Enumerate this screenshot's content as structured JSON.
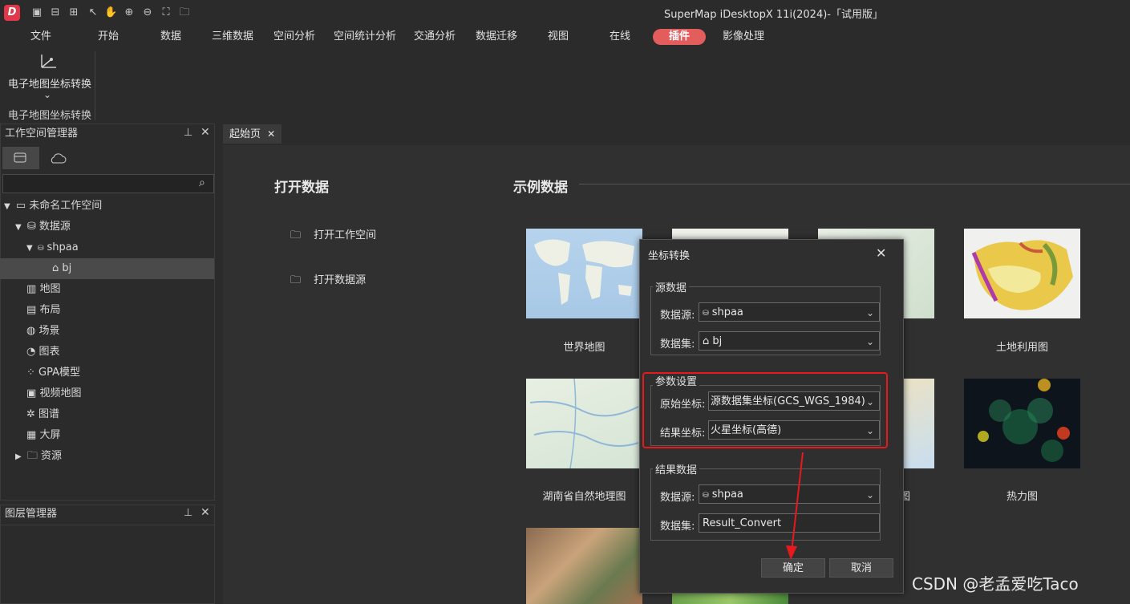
{
  "window": {
    "title": "SuperMap iDesktopX 11i(2024)-「试用版」",
    "logo": "D"
  },
  "quick_toolbar": [
    "save-icon",
    "import-icon",
    "export-icon",
    "select-icon",
    "pan-icon",
    "zoom-in-icon",
    "zoom-out-icon",
    "full-extent-icon",
    "open-folder-icon"
  ],
  "menu": {
    "items": [
      "文件",
      "开始",
      "数据",
      "三维数据",
      "空间分析",
      "空间统计分析",
      "交通分析",
      "数据迁移",
      "视图",
      "在线",
      "插件",
      "影像处理"
    ],
    "active_index": 10,
    "active_color": "#e35d5d"
  },
  "ribbon": {
    "button_label": "电子地图坐标转换",
    "group_label": "电子地图坐标转换"
  },
  "workspace_panel": {
    "title": "工作空间管理器",
    "search_placeholder": "",
    "tree": {
      "workspace": "未命名工作空间",
      "datasources": "数据源",
      "datasource": "shpaa",
      "dataset": "bj",
      "items": [
        "地图",
        "布局",
        "场景",
        "图表",
        "GPA模型",
        "视频地图",
        "图谱",
        "大屏",
        "资源"
      ]
    }
  },
  "layer_panel": {
    "title": "图层管理器"
  },
  "tabs": {
    "start_tab": "起始页"
  },
  "start_page": {
    "open_heading": "打开数据",
    "open_workspace": "打开工作空间",
    "open_datasource": "打开数据源",
    "sample_heading": "示例数据",
    "samples": [
      "世界地图",
      "土地利用图",
      "湖南省自然地理图",
      "热力图"
    ],
    "hidden_label_fragment": "图"
  },
  "dialog": {
    "title": "坐标转换",
    "source_group": "源数据",
    "source_datasource_label": "数据源:",
    "source_datasource_value": "shpaa",
    "source_dataset_label": "数据集:",
    "source_dataset_value": "bj",
    "param_group": "参数设置",
    "orig_coord_label": "原始坐标:",
    "orig_coord_value": "源数据集坐标(GCS_WGS_1984)",
    "result_coord_label": "结果坐标:",
    "result_coord_value": "火星坐标(高德)",
    "result_group": "结果数据",
    "result_datasource_label": "数据源:",
    "result_datasource_value": "shpaa",
    "result_dataset_label": "数据集:",
    "result_dataset_value": "Result_Convert",
    "ok": "确定",
    "cancel": "取消",
    "highlight_color": "#e8191d"
  },
  "watermark": "CSDN @老孟爱吃Taco"
}
